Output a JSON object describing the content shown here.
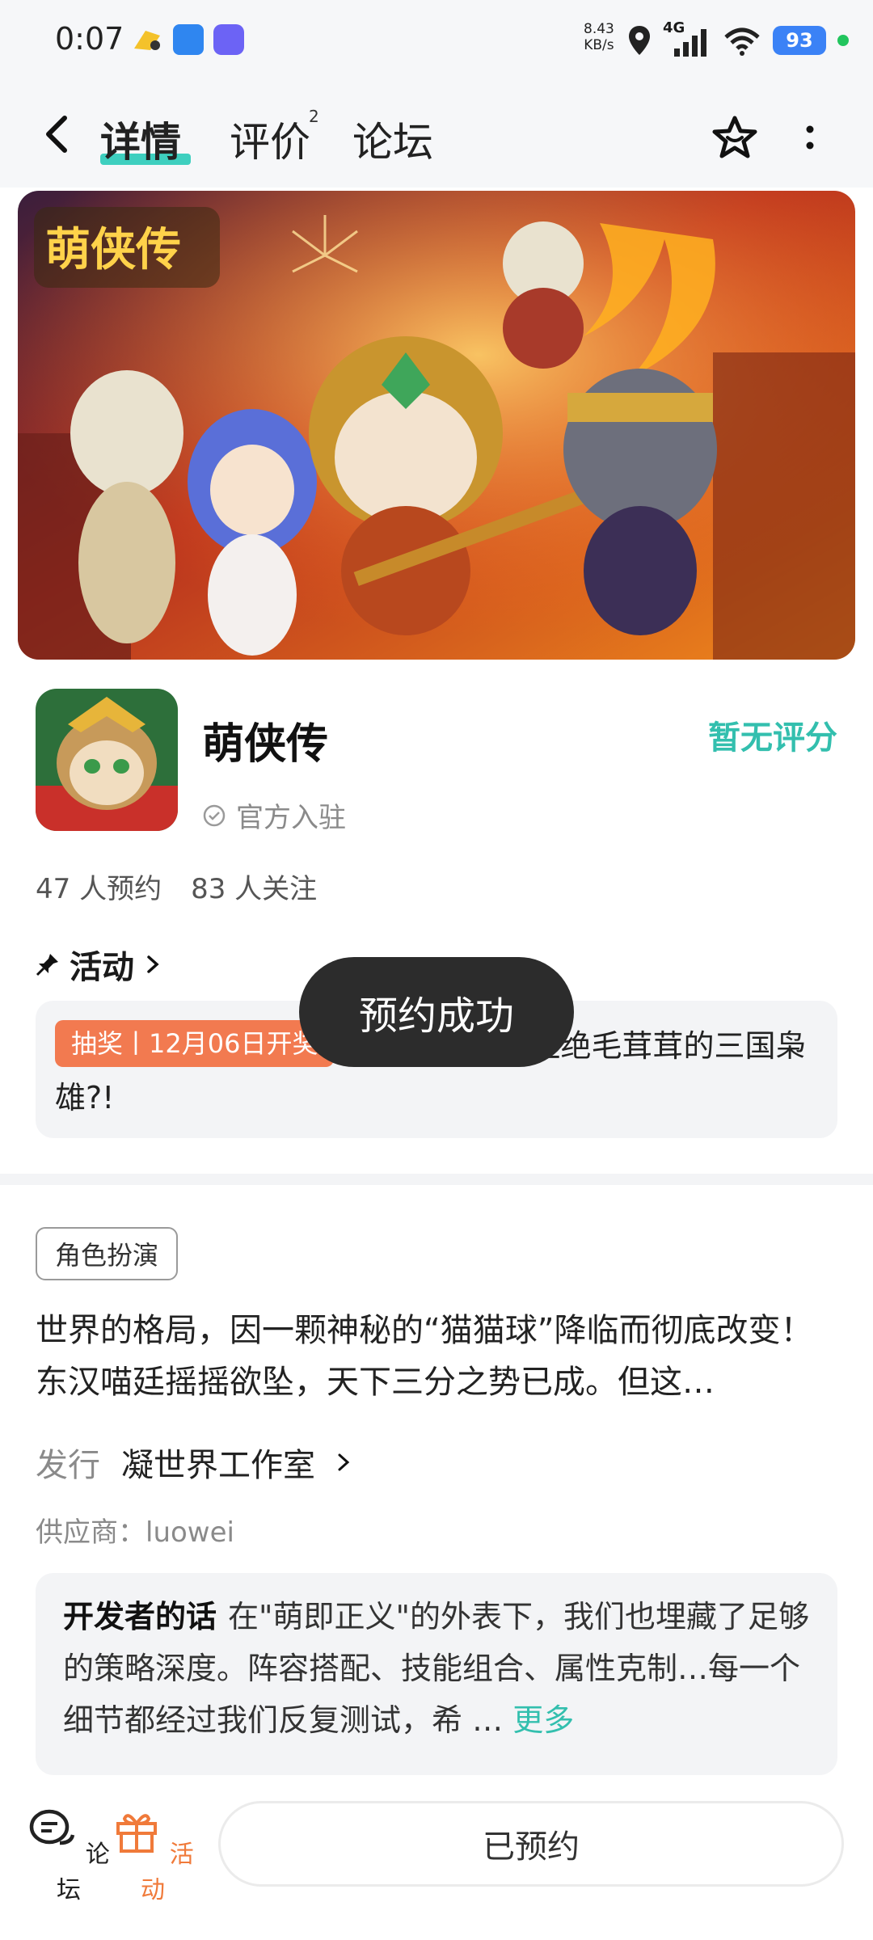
{
  "status_bar": {
    "time": "0:07",
    "speed_value": "8.43",
    "speed_unit": "KB/s",
    "network": "4G",
    "battery": "93"
  },
  "header": {
    "tabs": [
      {
        "label": "详情",
        "active": true
      },
      {
        "label": "评价",
        "badge": "2"
      },
      {
        "label": "论坛"
      }
    ]
  },
  "app": {
    "name": "萌侠传",
    "verified_label": "官方入驻",
    "rating": "暂无评分",
    "reservations": "47 人预约",
    "followers": "83 人关注"
  },
  "activity": {
    "title": "活动",
    "tag": "抽奖丨12月06日开奖",
    "text": "家人们！谁能拒绝毛茸茸的三国枭雄?!"
  },
  "toast": "预约成功",
  "details": {
    "genre": "角色扮演",
    "description": "世界的格局，因一颗神秘的“猫猫球”降临而彻底改变！东汉喵廷摇摇欲坠，天下三分之势已成。但这…",
    "publisher_label": "发行",
    "publisher": "凝世界工作室",
    "supplier": "供应商：luowei"
  },
  "developer": {
    "title": "开发者的话",
    "text": "在\"萌即正义\"的外表下，我们也埋藏了足够的策略深度。阵容搭配、技能组合、属性克制…每一个细节都经过我们反复测试，希 …",
    "more": "更多"
  },
  "bottom_bar": {
    "forum": "论坛",
    "activity": "活动",
    "reserve_button": "已预约"
  },
  "colors": {
    "accent": "#33bfae",
    "tab_underline": "#3ecfbf",
    "activity_tag": "#f27a50",
    "activity_icon": "#f07a3a"
  }
}
